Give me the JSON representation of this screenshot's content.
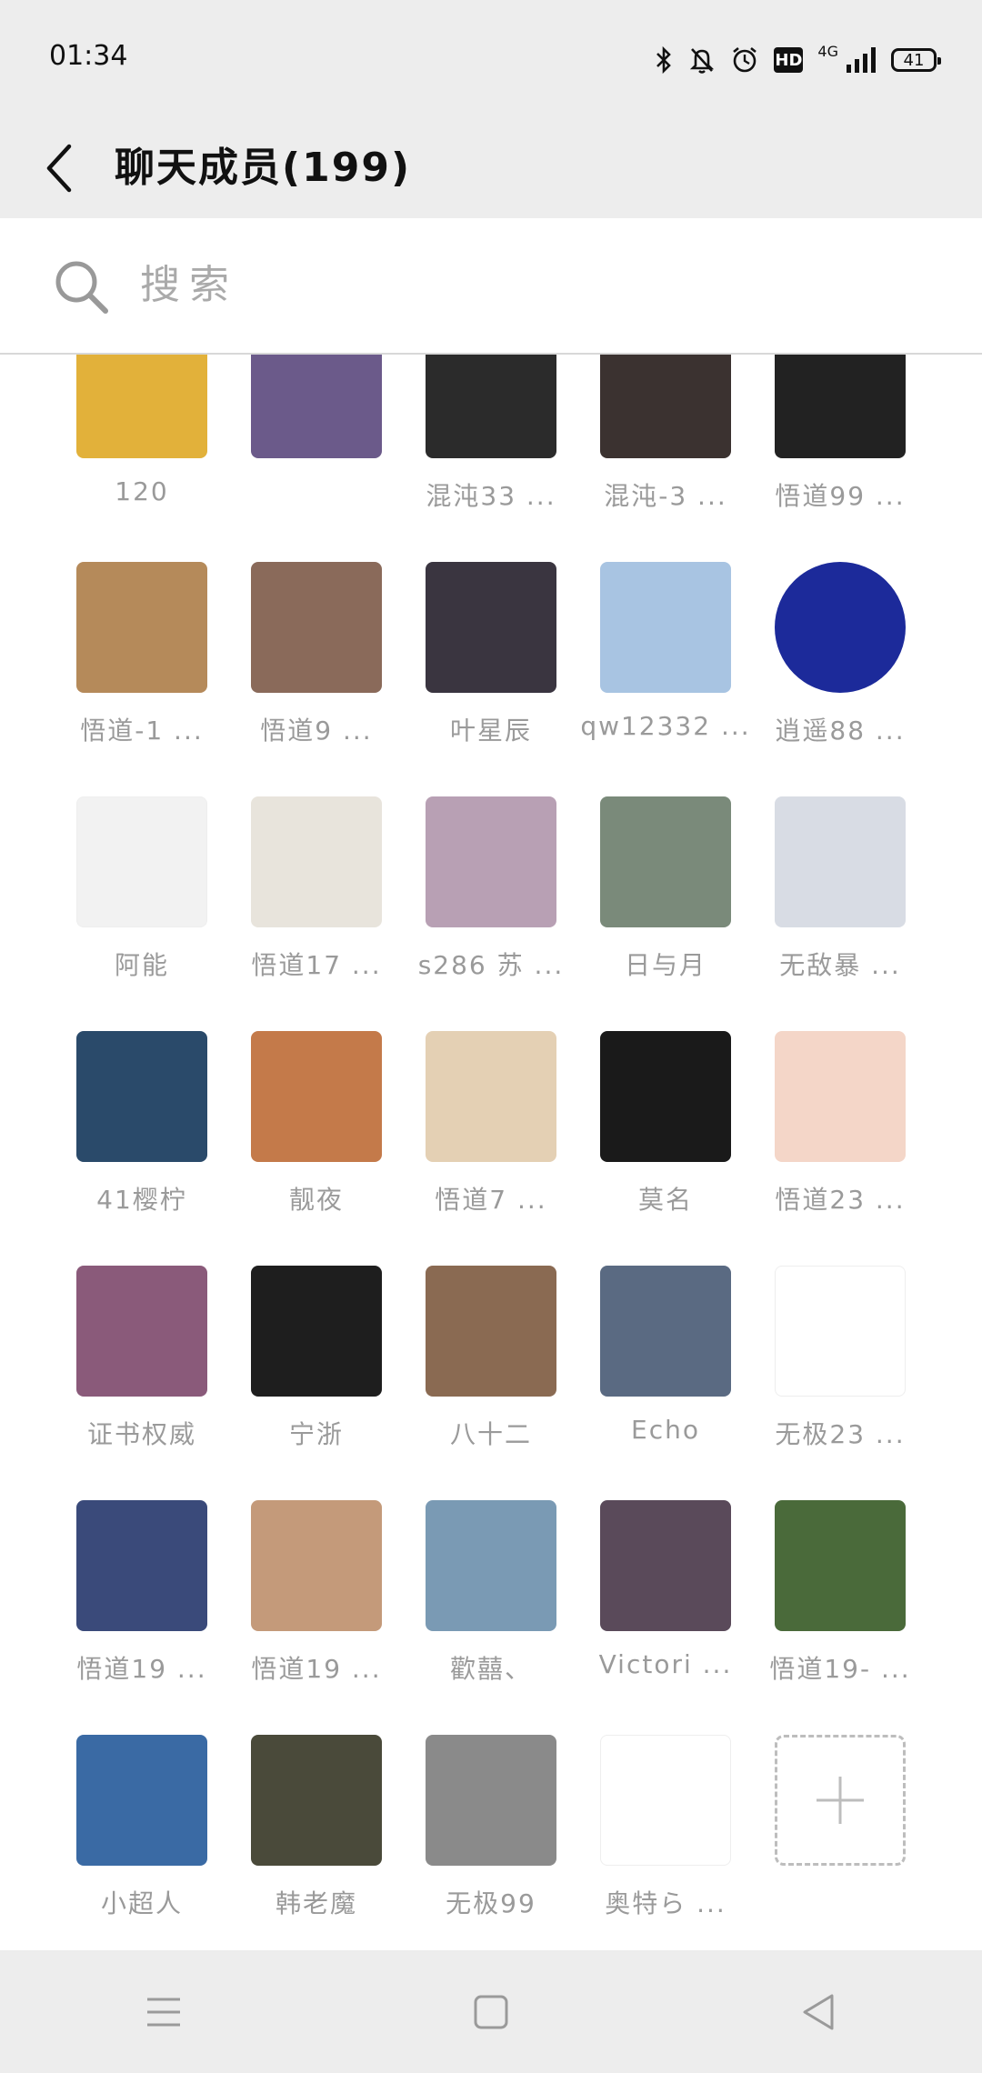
{
  "status_bar": {
    "time": "01:34",
    "network": "4G",
    "hd": "HD",
    "battery": "41",
    "icons": [
      "bluetooth-icon",
      "mute-bell-icon",
      "alarm-icon",
      "hd-icon",
      "signal-icon",
      "battery-icon"
    ]
  },
  "header": {
    "title": "聊天成员(199)",
    "back_icon": "chevron-left-icon"
  },
  "search": {
    "placeholder": "搜索",
    "icon": "search-icon"
  },
  "members": [
    {
      "name": "120",
      "color": "#e2b13a"
    },
    {
      "name": "",
      "color": "#6b5a8a"
    },
    {
      "name": "混沌33 ...",
      "color": "#2b2b2b"
    },
    {
      "name": "混沌-3 ...",
      "color": "#3b3230"
    },
    {
      "name": "悟道99 ...",
      "color": "#222222"
    },
    {
      "name": "悟道-1 ...",
      "color": "#b58a5a"
    },
    {
      "name": "悟道9 ...",
      "color": "#8a6a5a"
    },
    {
      "name": "叶星辰",
      "color": "#3a3540"
    },
    {
      "name": "qw12332 ...",
      "color": "#a8c4e2"
    },
    {
      "name": "逍遥88 ...",
      "color": "#1c2a9a"
    },
    {
      "name": "阿能",
      "color": "#f2f2f2"
    },
    {
      "name": "悟道17 ...",
      "color": "#e8e4dc"
    },
    {
      "name": "s286 苏 ...",
      "color": "#b8a0b4"
    },
    {
      "name": "日与月",
      "color": "#7a8a7a"
    },
    {
      "name": "无敌暴 ...",
      "color": "#d8dce4"
    },
    {
      "name": "41樱柠",
      "color": "#2a4a6a"
    },
    {
      "name": "靓夜",
      "color": "#c47a4a"
    },
    {
      "name": "悟道7 ...",
      "color": "#e4d0b4"
    },
    {
      "name": "莫名",
      "color": "#1a1a1a"
    },
    {
      "name": "悟道23 ...",
      "color": "#f4d6c8"
    },
    {
      "name": "证书权威",
      "color": "#8a5a7a"
    },
    {
      "name": "宁浙",
      "color": "#1e1e1e"
    },
    {
      "name": "八十二",
      "color": "#8a6a52"
    },
    {
      "name": "Echo",
      "color": "#5a6a82"
    },
    {
      "name": "无极23 ...",
      "color": "#ffffff"
    },
    {
      "name": "悟道19 ...",
      "color": "#3a4a7a"
    },
    {
      "name": "悟道19 ...",
      "color": "#c49a7a"
    },
    {
      "name": "歡囍、",
      "color": "#7a9ab4"
    },
    {
      "name": "Victori ...",
      "color": "#5a4a5a"
    },
    {
      "name": "悟道19- ...",
      "color": "#4a6a3a"
    },
    {
      "name": "小超人",
      "color": "#3a6aa4"
    },
    {
      "name": "韩老魔",
      "color": "#4a4a3a"
    },
    {
      "name": "无极99",
      "color": "#8a8a8a"
    },
    {
      "name": "奥特ら ...",
      "color": "#ffffff"
    }
  ],
  "add_member": {
    "icon": "plus-icon"
  },
  "nav_bar": {
    "icons": [
      "menu-icon",
      "home-square-icon",
      "back-triangle-icon"
    ]
  }
}
